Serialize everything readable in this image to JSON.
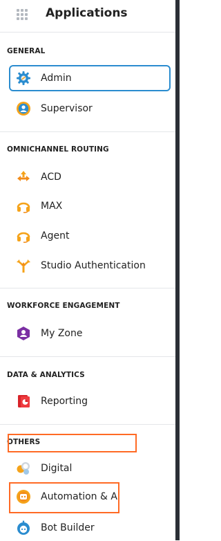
{
  "header": {
    "title": "Applications"
  },
  "sections": [
    {
      "key": "general",
      "title": "GENERAL",
      "items": [
        {
          "label": "Admin",
          "icon": "gear-icon"
        },
        {
          "label": "Supervisor",
          "icon": "supervisor-icon"
        }
      ]
    },
    {
      "key": "omni",
      "title": "OMNICHANNEL ROUTING",
      "items": [
        {
          "label": "ACD",
          "icon": "routing-arrows-icon"
        },
        {
          "label": "MAX",
          "icon": "headset-icon"
        },
        {
          "label": "Agent",
          "icon": "headset-icon"
        },
        {
          "label": "Studio Authentication",
          "icon": "studio-branch-icon"
        }
      ]
    },
    {
      "key": "wfe",
      "title": "WORKFORCE ENGAGEMENT",
      "items": [
        {
          "label": "My Zone",
          "icon": "user-hexagon-icon"
        }
      ]
    },
    {
      "key": "data",
      "title": "DATA & ANALYTICS",
      "items": [
        {
          "label": "Reporting",
          "icon": "report-chart-icon"
        }
      ]
    },
    {
      "key": "others",
      "title": "OTHERS",
      "items": [
        {
          "label": "Digital",
          "icon": "chat-bubbles-icon"
        },
        {
          "label": "Automation & AI",
          "icon": "robot-badge-icon"
        },
        {
          "label": "Bot Builder",
          "icon": "bot-icon"
        }
      ]
    }
  ],
  "colors": {
    "selection_border": "#2a8ccf",
    "annotation_border": "#ff6a24",
    "icon_orange": "#f5a31a",
    "icon_blue": "#2a8ccf",
    "icon_purple": "#7b2fa3",
    "icon_red": "#d8242a"
  }
}
